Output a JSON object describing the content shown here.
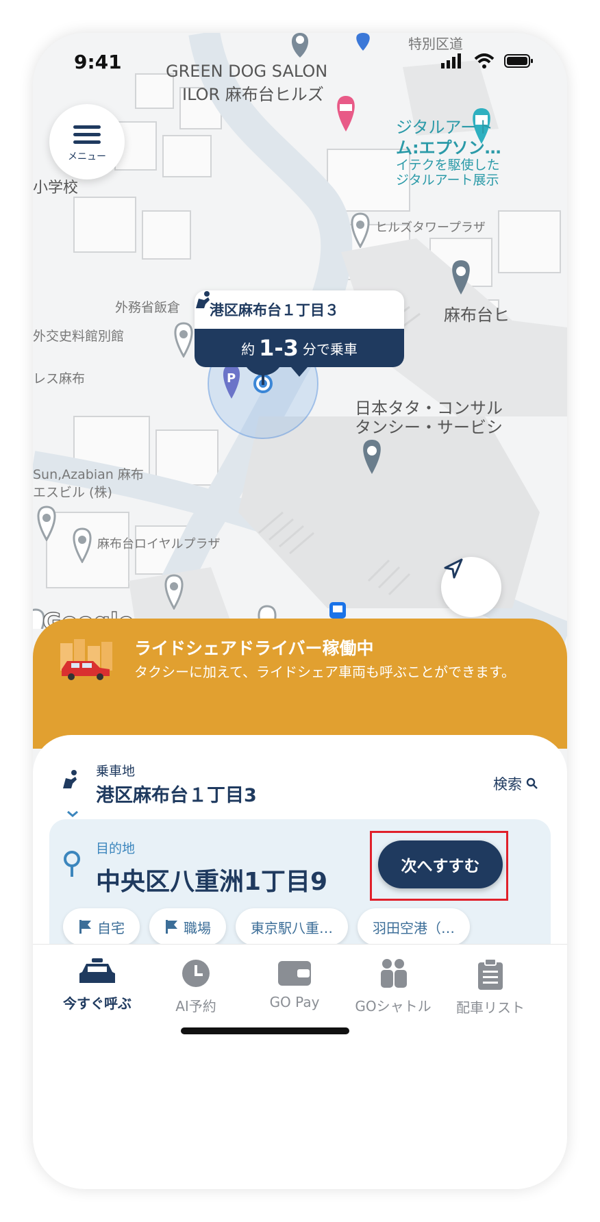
{
  "status": {
    "time": "9:41"
  },
  "menu": {
    "label": "メニュー"
  },
  "map": {
    "labels": {
      "salon_line1": "GREEN DOG SALON",
      "salon_line2": "ILOR 麻布台ヒルズ",
      "digital_line1": "ジタルアート",
      "digital_line2": "ム:エプソン…",
      "digital_line3": "イテクを駆使した",
      "digital_line4": "ジタルアート展示",
      "school": "小学校",
      "hills_tower": "ヒルズタワープラザ",
      "gaimusho": "外務省飯倉",
      "gaiko": "外交史料館別館",
      "residence": "レス麻布",
      "azabudai_hills": "麻布台ヒ",
      "tata_line1": "日本タタ・コンサル",
      "tata_line2": "タンシー・サービシ",
      "sun_line1": "Sun,Azabian 麻布",
      "sun_line2": "エスビル (株)",
      "royal_plaza": "麻布台ロイヤルプラザ",
      "google": "Google",
      "special_ward": "特別区道"
    }
  },
  "callout": {
    "pickup": "港区麻布台１丁目３",
    "eta_prefix": "約",
    "eta_range": "1-3",
    "eta_suffix": "分で乗車"
  },
  "banner": {
    "title": "ライドシェアドライバー稼働中",
    "description": "タクシーに加えて、ライドシェア車両も呼ぶことができます。"
  },
  "trip": {
    "pickup_label": "乗車地",
    "pickup_value": "港区麻布台１丁目3",
    "search_label": "検索",
    "destination_label": "目的地",
    "destination_value": "中央区八重洲1丁目9",
    "next_button": "次へすすむ"
  },
  "shortcuts": [
    {
      "label": "自宅",
      "icon": "flag-icon"
    },
    {
      "label": "職場",
      "icon": "flag-icon"
    },
    {
      "label": "東京駅八重…"
    },
    {
      "label": "羽田空港（…"
    }
  ],
  "tabs": [
    {
      "label": "今すぐ呼ぶ",
      "icon": "taxi-icon",
      "active": true
    },
    {
      "label": "AI予約",
      "icon": "clock-icon"
    },
    {
      "label": "GO Pay",
      "icon": "wallet-icon"
    },
    {
      "label": "GOシャトル",
      "icon": "people-icon"
    },
    {
      "label": "配車リスト",
      "icon": "clipboard-icon"
    }
  ],
  "colors": {
    "navy": "#1f3a5f",
    "banner": "#e1a030",
    "highlight": "#e0202a"
  }
}
